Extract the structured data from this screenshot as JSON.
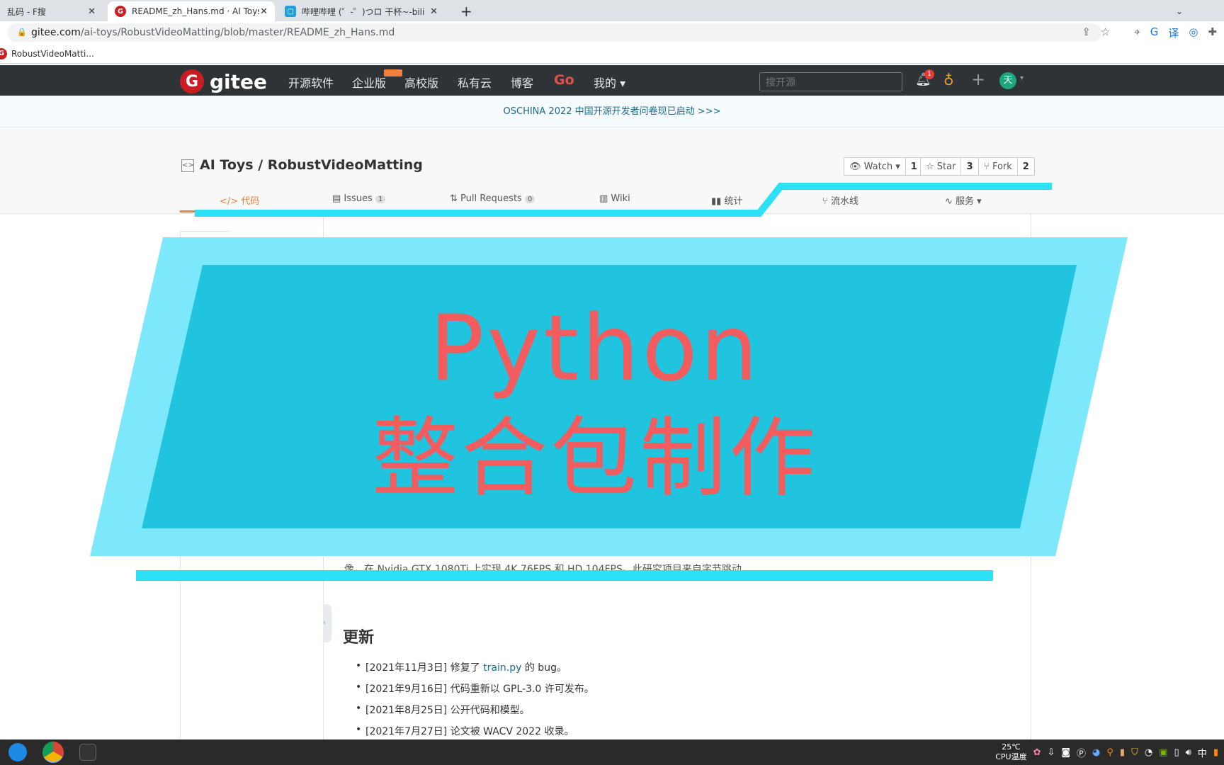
{
  "browser": {
    "tabs": [
      {
        "label": "乱码 - F搜"
      },
      {
        "label": "README_zh_Hans.md · AI Toys"
      },
      {
        "label": "哔哩哔哩 (゜-゜)つロ 干杯~-bili"
      }
    ],
    "new_tab": "+",
    "url_host": "gitee.com",
    "url_path": "/ai-toys/RobustVideoMatting/blob/master/README_zh_Hans.md",
    "bookmark": "RobustVideoMatti..."
  },
  "gitee": {
    "logo": "gitee",
    "nav": [
      "开源软件",
      "企业版",
      "高校版",
      "私有云",
      "博客",
      "Go",
      "我的"
    ],
    "search_placeholder": "搜开源",
    "notif_count": "1",
    "avatar": "天",
    "banner": "OSCHINA 2022 中国开源开发者问卷现已启动 >>>",
    "repo_title": "AI Toys / RobustVideoMatting",
    "watch": {
      "label": "Watch",
      "count": "1"
    },
    "star": {
      "label": "Star",
      "count": "3"
    },
    "fork": {
      "label": "Fork",
      "count": "2"
    },
    "tabs": [
      {
        "label": "代码"
      },
      {
        "label": "Issues",
        "count": "1"
      },
      {
        "label": "Pull Requests",
        "count": "0"
      },
      {
        "label": "Wiki"
      },
      {
        "label": "统计"
      },
      {
        "label": "流水线"
      },
      {
        "label": "服务"
      }
    ]
  },
  "readme": {
    "partial_line": "像，在 Nvidia GTX 1080Ti 上实现 4K 76FPS 和 HD 104FPS。此研究项目来自字节跳动",
    "heading": "更新",
    "updates": [
      {
        "date": "[2021年11月3日]",
        "pre": " 修复了 ",
        "link": "train.py",
        "post": " 的 bug。"
      },
      {
        "date": "[2021年9月16日]",
        "pre": " 代码重新以 GPL-3.0 许可发布。"
      },
      {
        "date": "[2021年8月25日]",
        "pre": " 公开代码和模型。"
      },
      {
        "date": "[2021年7月27日]",
        "pre": " 论文被 WACV 2022 收录。"
      }
    ]
  },
  "overlay": {
    "line1": "Python",
    "line2": "整合包制作",
    "colors": {
      "outer": "#7de8fb",
      "inner": "#20c4de",
      "text": "#f25c5e",
      "accent": "#2ee0f5"
    }
  },
  "taskbar": {
    "temp": "25℃",
    "temp_label": "CPU温度",
    "ime": "中"
  }
}
